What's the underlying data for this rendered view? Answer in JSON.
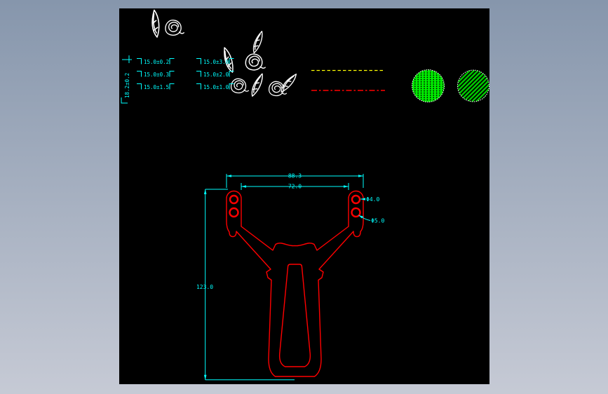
{
  "colors": {
    "bg_top": "#8696ac",
    "bg_bottom": "#c6cad5",
    "canvas": "#000000",
    "cyan": "#00ffff",
    "red": "#ff0000",
    "yellow": "#ffff00",
    "green": "#00ee00",
    "white": "#ffffff"
  },
  "tolerances": {
    "vertical_label": "18.2±0.2",
    "entries": [
      "15.0±0.2",
      "15.0±3.0",
      "15.0±0.3",
      "15.0±2.0",
      "15.0±1.5",
      "15.0±1.0"
    ]
  },
  "dimensions": {
    "outer_width": "88.3",
    "inner_width": "72.0",
    "overall_height": "123.0",
    "hole_small_dia": "Φ4.0",
    "hole_large_dia": "Φ5.0"
  }
}
